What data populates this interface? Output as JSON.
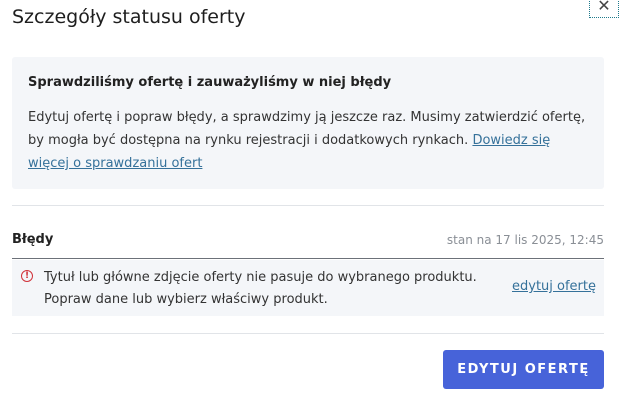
{
  "dialog": {
    "title": "Szczegóły statusu oferty",
    "close_label": "✕"
  },
  "info": {
    "heading": "Sprawdziliśmy ofertę i zauważyliśmy w niej błędy",
    "text": "Edytuj ofertę i popraw błędy, a sprawdzimy ją jeszcze raz. Musimy zatwierdzić ofertę, by mogła być dostępna na rynku rejestracji i dodatkowych rynkach.",
    "link": "Dowiedz się więcej o sprawdzaniu ofert"
  },
  "errors": {
    "title": "Błędy",
    "timestamp": "stan na 17 lis 2025, 12:45",
    "items": [
      {
        "icon": "!",
        "line1": "Tytuł lub główne zdjęcie oferty nie pasuje do wybranego produktu.",
        "line2": "Popraw dane lub wybierz właściwy produkt.",
        "action": "edytuj ofertę"
      }
    ]
  },
  "footer": {
    "primary_label": "EDYTUJ OFERTĘ"
  },
  "colors": {
    "primary": "#4763d9",
    "link": "#35719a",
    "error": "#d0323a",
    "panel_bg": "#f4f6f9"
  }
}
